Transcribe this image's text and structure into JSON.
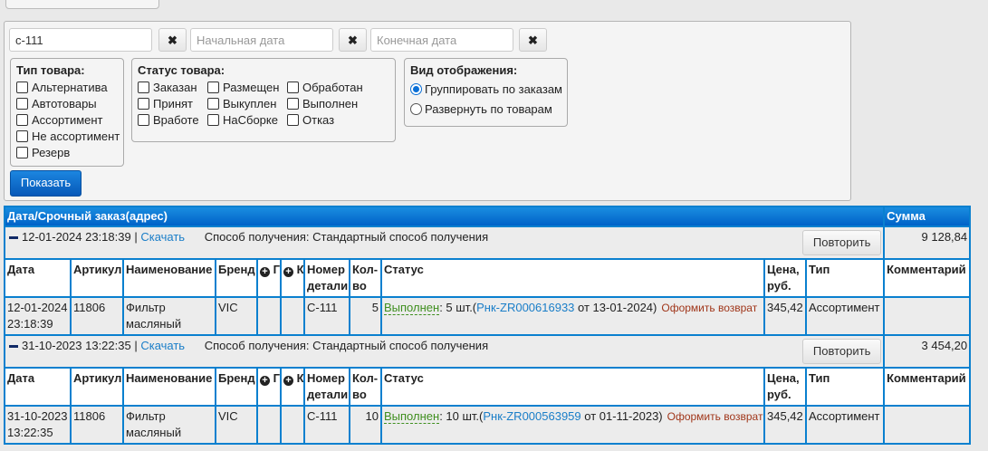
{
  "filters": {
    "search_value": "с-111",
    "start_placeholder": "Начальная дата",
    "end_placeholder": "Конечная дата",
    "clear": "✖",
    "type": {
      "title": "Тип товара:",
      "items": [
        "Альтернатива",
        "Автотовары",
        "Ассортимент",
        "Не ассортимент",
        "Резерв"
      ]
    },
    "status": {
      "title": "Статус товара:",
      "items": [
        "Заказан",
        "Размещен",
        "Обработан",
        "Принят",
        "Выкуплен",
        "Выполнен",
        "Вработе",
        "НаСборке",
        "Отказ"
      ]
    },
    "view": {
      "title": "Вид отображения:",
      "options": [
        "Группировать по заказам",
        "Развернуть по товарам"
      ],
      "selected": 0
    },
    "show_label": "Показать"
  },
  "table": {
    "header": "Дата/Срочный заказ(адрес)",
    "sum_header": "Сумма",
    "columns": [
      "Дата",
      "Артикул",
      "Наименование",
      "Бренд",
      "Г",
      "К",
      "Номер детали",
      "Кол-во",
      "Статус",
      "Цена, руб.",
      "Тип",
      "Комментарий"
    ],
    "download": "Скачать",
    "delivery_label": "Способ получения:",
    "repeat": "Повторить",
    "return": "Оформить возврат",
    "orders": [
      {
        "datetime": "12-01-2024 23:18:39",
        "delivery": "Стандартный способ получения",
        "sum": "9 128,84",
        "item": {
          "date": "12-01-2024",
          "time": "23:18:39",
          "article": "11806",
          "name": "Фильтр масляный",
          "brand": "VIC",
          "part": "C-111",
          "qty": "5",
          "status": "Выполнен",
          "status_qty": ": 5 шт.(",
          "doc": "Рнк-ZR000616933",
          "doc_date": " от 13-01-2024)",
          "price": "345,42",
          "type": "Ассортимент",
          "comment": ""
        }
      },
      {
        "datetime": "31-10-2023 13:22:35",
        "delivery": "Стандартный способ получения",
        "sum": "3 454,20",
        "item": {
          "date": "31-10-2023",
          "time": "13:22:35",
          "article": "11806",
          "name": "Фильтр масляный",
          "brand": "VIC",
          "part": "C-111",
          "qty": "10",
          "status": "Выполнен",
          "status_qty": ": 10 шт.(",
          "doc": "Рнк-ZR000563959",
          "doc_date": " от 01-11-2023)",
          "price": "345,42",
          "type": "Ассортимент",
          "comment": ""
        }
      }
    ]
  }
}
